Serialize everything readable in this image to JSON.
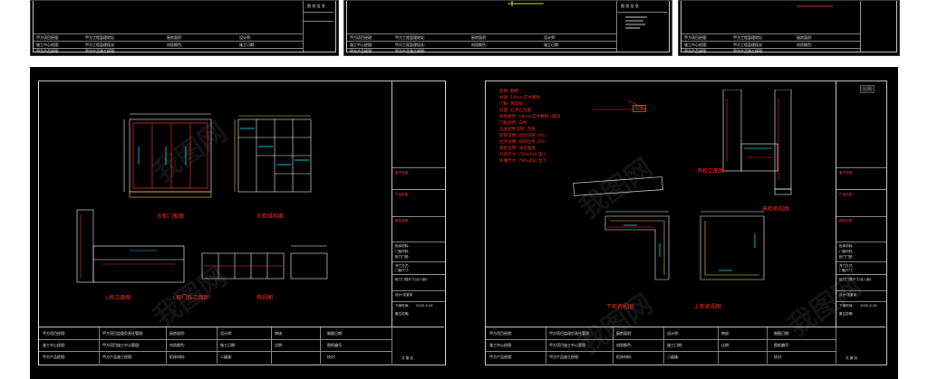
{
  "watermark": "我图网",
  "top_strip": {
    "sheet1": {
      "stamp": "图 纸 信 息",
      "table": [
        [
          "甲方项目经理:",
          "甲方工程监理地址:",
          "厨房面积:",
          "设计师:"
        ],
        [
          "施工中心经理:",
          "甲方工程监理组长:",
          "材质颜色:",
          "施工日期:"
        ],
        [
          "甲方产品经理:",
          "甲方产品施工经理:",
          "柜体材料:",
          "审核:"
        ]
      ]
    },
    "sheet2": {
      "stamp": "图 纸 信 息",
      "table": [
        [
          "甲方项目经理:",
          "甲方工程监理地址:",
          "厨房面积:",
          "设计师:"
        ],
        [
          "施工中心经理:",
          "甲方工程监理组长:",
          "材质颜色:",
          "施工日期:"
        ],
        [
          "甲方产品经理:",
          "甲方产品施工经理:",
          "柜体材料:",
          "审核:"
        ]
      ]
    },
    "sheet3": {
      "table": [
        [
          "甲方项目经理:",
          "甲方工程监理地址:",
          "厨房面积:",
          "设计师:"
        ],
        [
          "施工中心经理:",
          "甲方工程监理组长:",
          "材质颜色:",
          "施工日期:"
        ],
        [
          "甲方产品经理:",
          "甲方产品施工经理:",
          "柜体材料:",
          "审核:"
        ]
      ]
    }
  },
  "left_sheet": {
    "labels": {
      "front_door": "衣柜门板图",
      "inner_structure": "衣柜结构图",
      "l_elevation": "L柜立面图",
      "l_door_elevation": "L柜门板立面图",
      "side_view": "侧视图"
    },
    "title_block": {
      "rows": [
        "客户信息:",
        "产品信息:",
        "颜色材质:",
        "柜体材料:",
        "门板材料:",
        "柜门门型:",
        "开门方式:",
        "门板尺寸:",
        "柜门门洞尺寸(合八扇):",
        "设计:张某某",
        "下单时间:",
        "2020-5-26",
        "备注说明:"
      ],
      "sign": "共  第  张"
    },
    "bottom_table": [
      [
        "甲方项目经理:",
        "甲方项目监理负责任管理:",
        "厨房面积:",
        "设计师:",
        "审核:",
        "制图日期:"
      ],
      [
        "施工中心经理:",
        "甲方项目施工中心管理:",
        "材质颜色:",
        "施工日期:",
        "比例:",
        "图纸编号:"
      ],
      [
        "甲方产品经理:",
        "甲方产品施工经理:",
        "柜体材料:",
        "二级施:",
        "",
        "校对:"
      ]
    ]
  },
  "right_sheet": {
    "notes": [
      "名称: 橱柜",
      "材质: 18mm实木颗粒",
      "门板: 烤漆板",
      "台面: 石英石台面",
      "柜体颜色: 18mm实木颗粒+暖白",
      "门板颜色: 白色",
      "五金配件说明: 百隆",
      "铰链说明: 阻尼铰链 (AV)",
      "拉手说明: 隐形拉手 (2V)",
      "其他说明: 详见图纸",
      "灶具尺寸: 750x430   嵌入",
      "水槽尺寸: 780x450   台下"
    ],
    "labels": {
      "upper_elevation": "吊柜立面图",
      "tall_cabinet": "高柜侧视图",
      "lower_plan": "下柜俯视图",
      "upper_plan": "上柜俯视图"
    },
    "small_tag": "标注",
    "zoom_tab": "比例",
    "title_block": {
      "rows": [
        "客户信息:",
        "产品信息:",
        "颜色材质:",
        "柜体材料:",
        "门板材料:",
        "柜门门型:",
        "开门方式:",
        "门板尺寸:",
        "柜门门洞尺寸(合八扇):",
        "设计:张某某",
        "下单时间:",
        "2020-5-26",
        "备注说明:"
      ],
      "sign": "共  第  张"
    },
    "bottom_table": [
      [
        "甲方项目经理:",
        "甲方项目监理负责任管理:",
        "厨房面积:",
        "设计师:",
        "审核:",
        "制图日期:"
      ],
      [
        "施工中心经理:",
        "甲方项目施工中心管理:",
        "材质颜色:",
        "施工日期:",
        "比例:",
        "图纸编号:"
      ],
      [
        "甲方产品经理:",
        "甲方产品施工经理:",
        "柜体材料:",
        "二级施:",
        "",
        "校对:"
      ]
    ]
  },
  "colors": {
    "background": "#000000",
    "frame": "#d9d9d9",
    "accent_red": "#ff2a2a",
    "accent_cyan": "#00e5ff",
    "accent_yellow": "#ffd84a"
  }
}
